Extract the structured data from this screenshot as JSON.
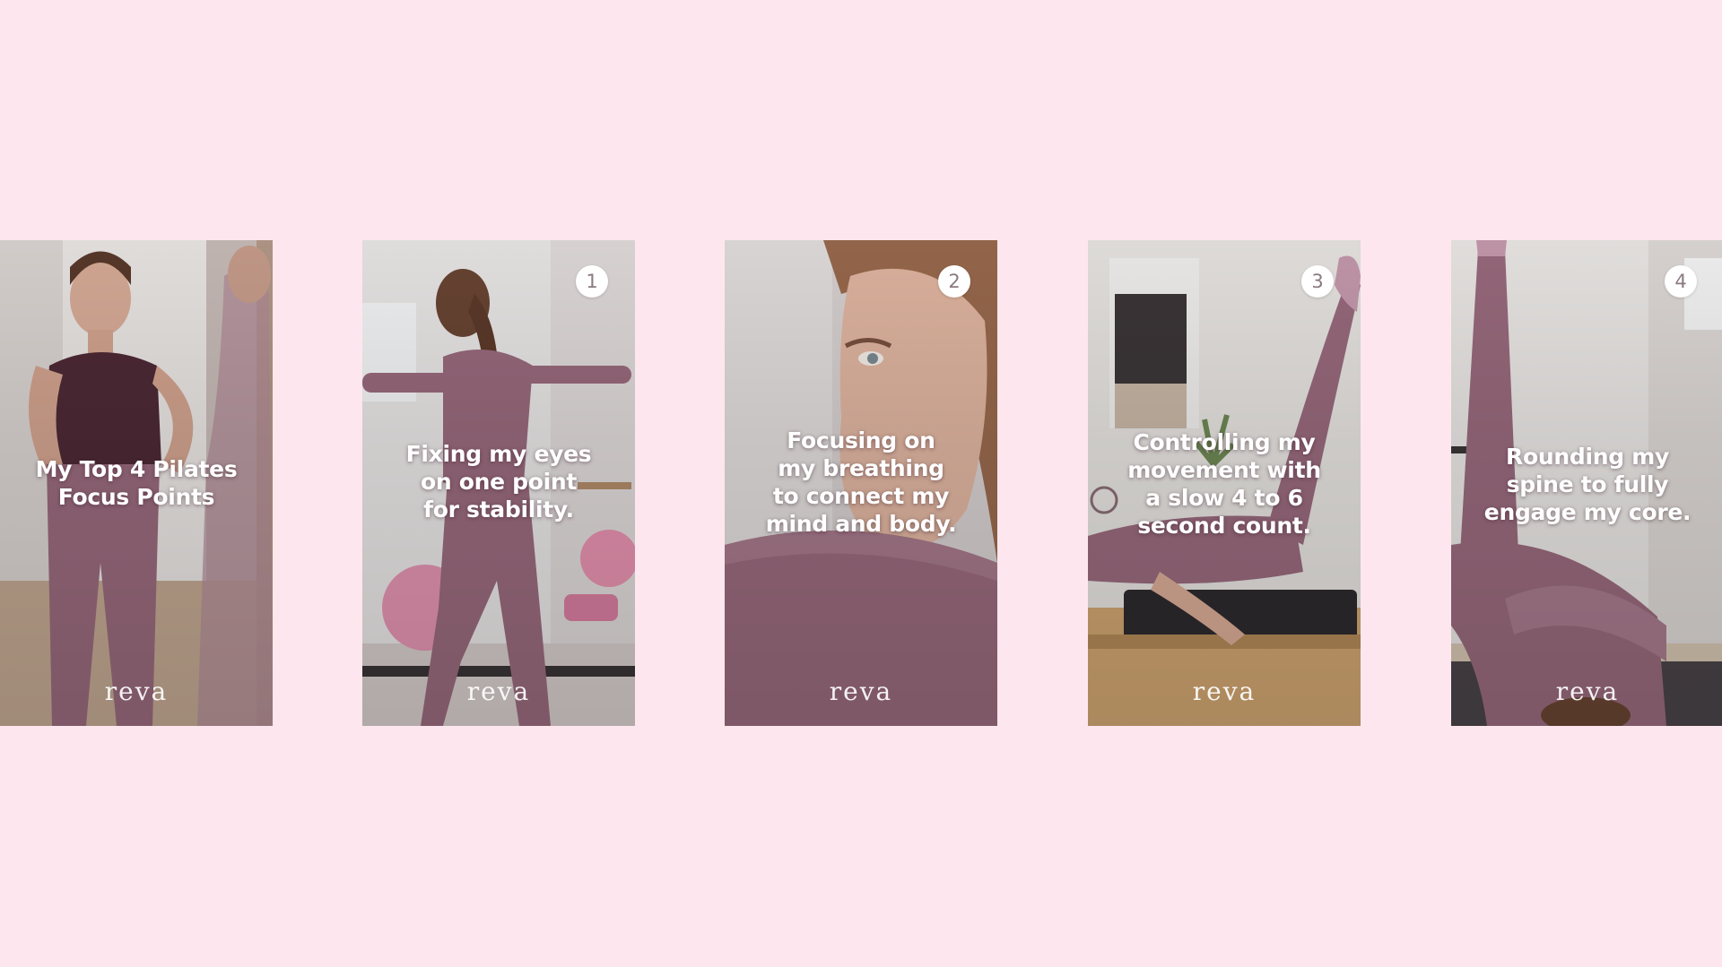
{
  "cards": [
    {
      "caption": "My Top 4  Pilates\nFocus Points",
      "number": "",
      "logo": "reva"
    },
    {
      "caption": "Fixing my eyes\non one point\nfor stability.",
      "number": "1",
      "logo": "reva"
    },
    {
      "caption": "Focusing on\nmy breathing\nto connect my\nmind and body.",
      "number": "2",
      "logo": "reva"
    },
    {
      "caption": "Controlling my\nmovement with\na slow 4 to 6\nsecond count.",
      "number": "3",
      "logo": "reva"
    },
    {
      "caption": "Rounding my\nspine to fully\nengage my core.",
      "number": "4",
      "logo": "reva"
    }
  ],
  "colors": {
    "background": "#fde6ee",
    "outfit": "#9a6b7e",
    "caption_text": "#ffffff"
  }
}
